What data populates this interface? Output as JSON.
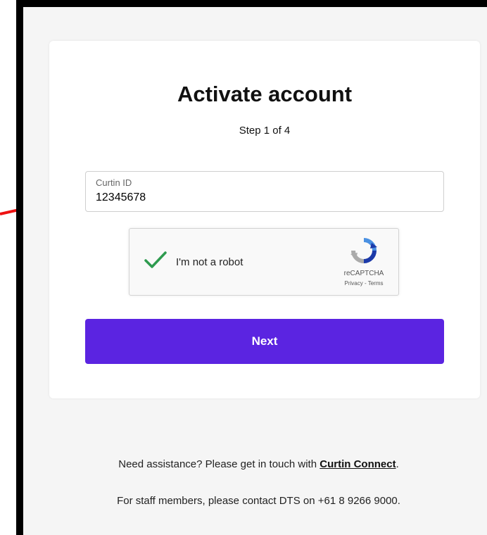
{
  "card": {
    "title": "Activate account",
    "step": "Step 1 of 4"
  },
  "id_field": {
    "label": "Curtin ID",
    "value": "12345678"
  },
  "captcha": {
    "checked": true,
    "label": "I'm not a robot",
    "brand": "reCAPTCHA",
    "privacy": "Privacy",
    "separator": " - ",
    "terms": "Terms",
    "icon": "recaptcha-logo-icon"
  },
  "next_button": {
    "label": "Next"
  },
  "footer": {
    "assist_text": "Need assistance? Please get in touch with ",
    "assist_link": "Curtin Connect",
    "assist_end": ".",
    "staff_text": "For staff members, please contact DTS on +61 8 9266 9000."
  },
  "colors": {
    "primary": "#5b24e1",
    "check": "#2e9b4f",
    "annotation_arrow": "#ee1111",
    "background": "#f5f5f5"
  }
}
